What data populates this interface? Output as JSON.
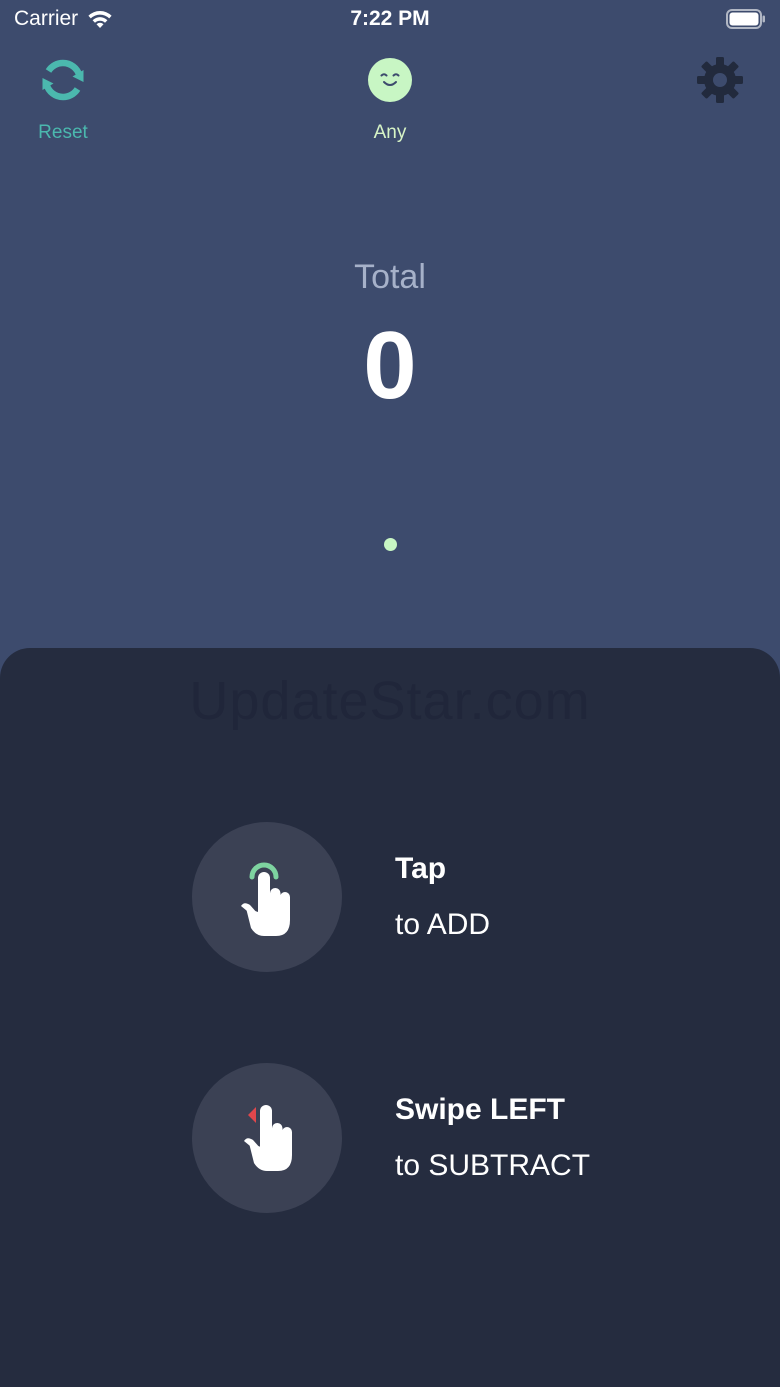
{
  "status_bar": {
    "carrier": "Carrier",
    "time": "7:22 PM",
    "wifi_icon": "wifi-icon",
    "battery_icon": "battery-full-icon"
  },
  "top_bar": {
    "reset": {
      "label": "Reset",
      "icon": "refresh-icon",
      "color": "#4bb8ae"
    },
    "mode": {
      "label": "Any",
      "icon": "smiley-face-icon",
      "color": "#d7f4c6"
    },
    "settings": {
      "icon": "gear-icon",
      "color": "#222a3d"
    }
  },
  "counter": {
    "label": "Total",
    "value": "0"
  },
  "pager": {
    "pages": 1,
    "active": 1
  },
  "watermark": "UpdateStar.com",
  "hints": [
    {
      "icon": "tap-hand-icon",
      "title": "Tap",
      "subtitle": "to ADD"
    },
    {
      "icon": "swipe-left-hand-icon",
      "title": "Swipe LEFT",
      "subtitle": "to SUBTRACT"
    }
  ],
  "colors": {
    "background": "#3d4b6d",
    "panel": "#252c3f",
    "hint_circle": "#3b4154",
    "accent_teal": "#4bb8ae",
    "accent_green": "#7ed3a0",
    "accent_red": "#e0474c"
  }
}
